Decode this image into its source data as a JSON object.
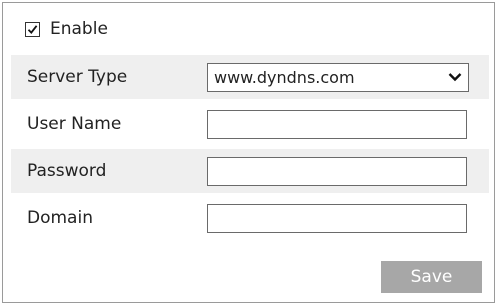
{
  "enable": {
    "label": "Enable",
    "checked": true
  },
  "form": {
    "server_type": {
      "label": "Server Type",
      "selected": "www.dyndns.com"
    },
    "user_name": {
      "label": "User Name",
      "value": ""
    },
    "password": {
      "label": "Password",
      "value": ""
    },
    "domain": {
      "label": "Domain",
      "value": ""
    }
  },
  "actions": {
    "save_label": "Save"
  },
  "icons": {
    "checkbox": "check-icon",
    "dropdown": "chevron-down-icon"
  },
  "colors": {
    "row_alt_bg": "#efefef",
    "border": "#9a9a9a",
    "field_border": "#6a6a6a",
    "save_bg": "#a7a7a7",
    "save_text": "#ffffff"
  }
}
